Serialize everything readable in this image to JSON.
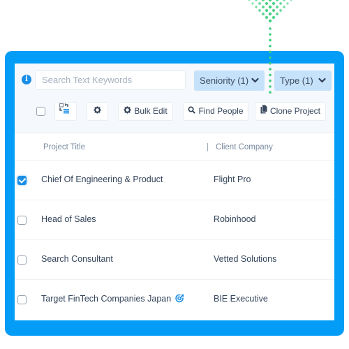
{
  "search": {
    "placeholder": "Search Text Keywords",
    "value": ""
  },
  "filters": [
    {
      "label": "Seniority (1)",
      "icon": "chevron-down-icon"
    },
    {
      "label": "Type (1)",
      "icon": "chevron-down-icon"
    }
  ],
  "toolbar": {
    "select_all_checked": false,
    "move_icon": "move-to-list-icon",
    "settings_icon": "gear-icon",
    "bulk_edit_label": "Bulk Edit",
    "find_people_label": "Find People",
    "clone_project_label": "Clone Project"
  },
  "table": {
    "headers": [
      "Project Title",
      "Client Company"
    ],
    "rows": [
      {
        "title": "Chief Of Engineering & Product",
        "company": "Flight Pro",
        "checked": true,
        "badge": ""
      },
      {
        "title": "Head of Sales",
        "company": "Robinhood",
        "checked": false,
        "badge": ""
      },
      {
        "title": "Search Consultant",
        "company": "Vetted Solutions",
        "checked": false,
        "badge": ""
      },
      {
        "title": "Target FinTech Companies Japan",
        "company": "BIE Executive",
        "checked": false,
        "badge": "target-icon"
      }
    ]
  },
  "colors": {
    "frame": "#039cf6",
    "accent": "#1a8ee6",
    "filter_bg": "#c6e2fa",
    "dots": "#3fcf7f"
  }
}
